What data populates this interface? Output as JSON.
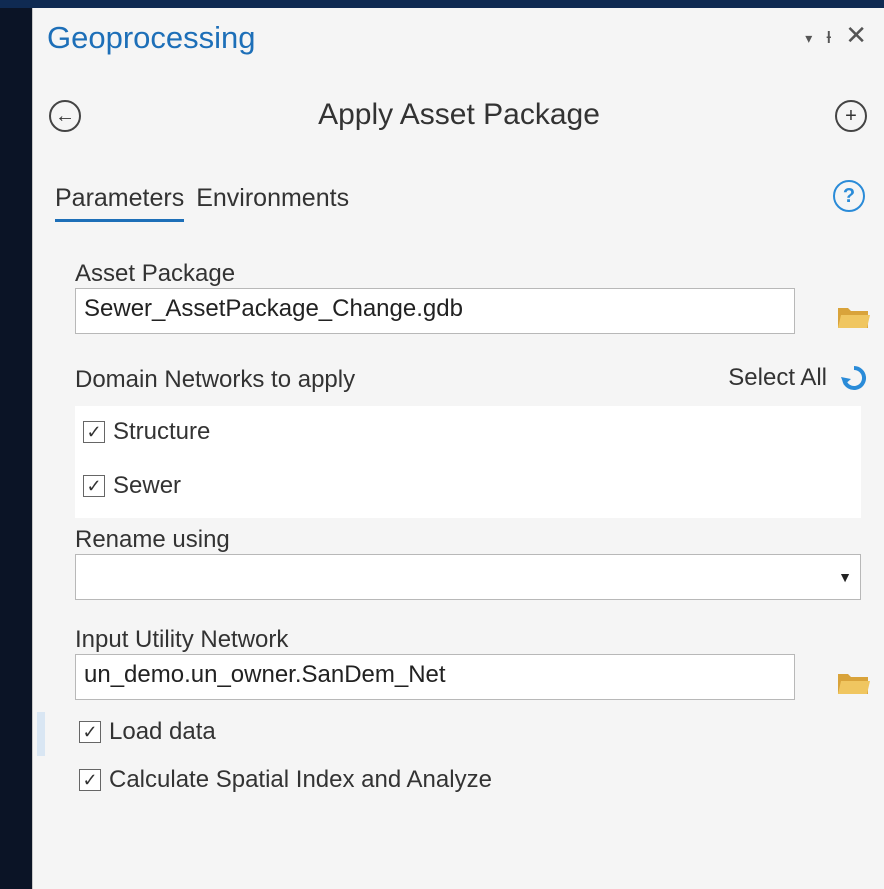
{
  "panel": {
    "title": "Geoprocessing",
    "window_controls": {
      "dropdown": "▾",
      "pin": "ᵻ",
      "close": "✕"
    }
  },
  "tool": {
    "title": "Apply Asset Package",
    "back_symbol": "←",
    "add_symbol": "+"
  },
  "tabs": [
    {
      "label": "Parameters",
      "active": true
    },
    {
      "label": "Environments",
      "active": false
    }
  ],
  "help_symbol": "?",
  "params": {
    "asset_package": {
      "label": "Asset Package",
      "value": "Sewer_AssetPackage_Change.gdb",
      "icon": "folder-icon"
    },
    "domain_networks": {
      "label": "Domain Networks to apply",
      "select_all": "Select All",
      "items": [
        {
          "label": "Structure",
          "checked": true
        },
        {
          "label": "Sewer",
          "checked": true
        }
      ]
    },
    "rename_using": {
      "label": "Rename using",
      "value": ""
    },
    "input_network": {
      "label": "Input Utility Network",
      "value": "un_demo.un_owner.SanDem_Net",
      "icon": "folder-icon"
    },
    "load_data": {
      "label": "Load data",
      "checked": true
    },
    "calc_index": {
      "label": "Calculate Spatial Index and Analyze",
      "checked": true
    }
  },
  "colors": {
    "accent": "#1d6fb8",
    "help": "#2a8bd8",
    "folder": "#e8b84a",
    "background": "#0b1426"
  }
}
